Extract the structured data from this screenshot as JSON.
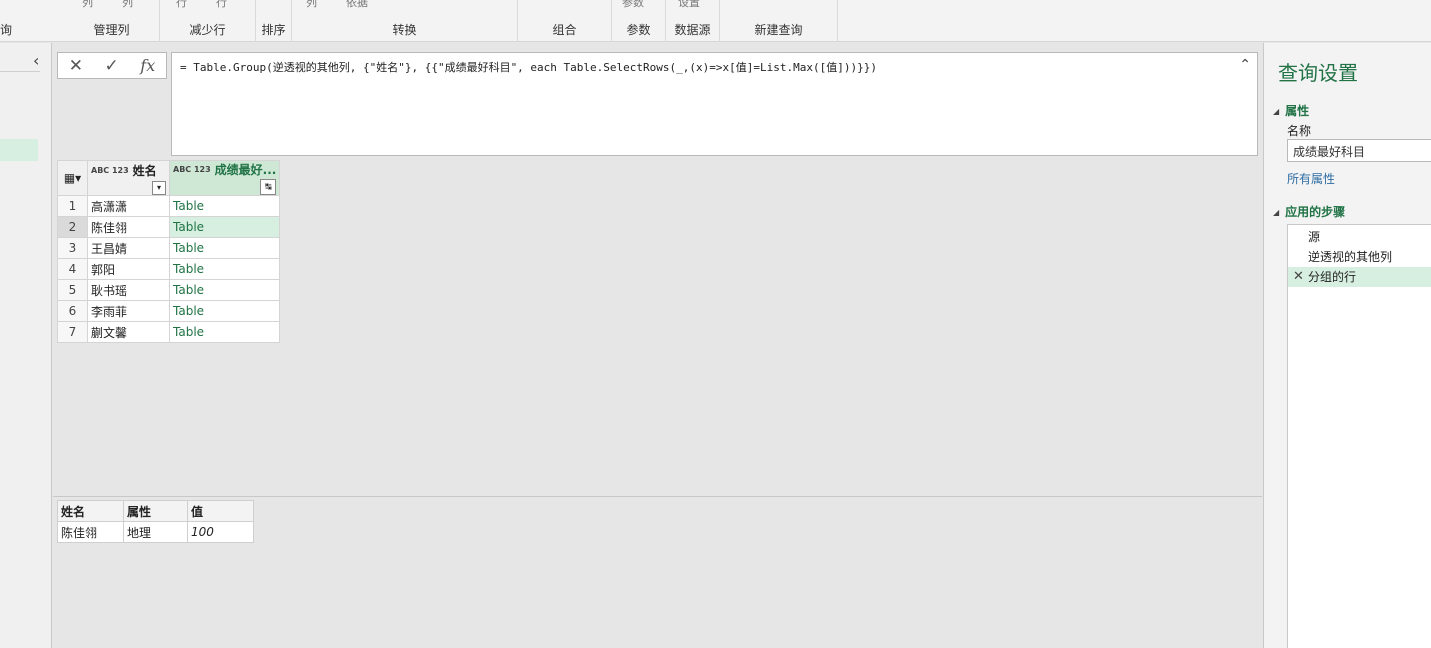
{
  "ribbon": {
    "left_clip": "询",
    "peek": {
      "col1": "列",
      "col2": "列",
      "row1": "行",
      "row2": "行",
      "col3": "列",
      "basis": "依据",
      "param": "参数",
      "settings": "设置"
    },
    "groups": {
      "manage_columns": "管理列",
      "reduce_rows": "减少行",
      "sort": "排序",
      "transform": "转换",
      "combine": "组合",
      "parameters": "参数",
      "data_source": "数据源",
      "new_query": "新建查询"
    }
  },
  "formula": {
    "cancel_icon": "✕",
    "confirm_icon": "✓",
    "fx_icon": "fx",
    "text": "= Table.Group(逆透视的其他列, {\"姓名\"}, {{\"成绩最好科目\", each Table.SelectRows(_,(x)=>x[值]=List.Max([值]))}})",
    "expand_icon": "⌃"
  },
  "grid": {
    "columns": [
      {
        "type": "ABC 123",
        "name": "姓名"
      },
      {
        "type": "ABC 123",
        "name": "成绩最好..."
      }
    ],
    "rows": [
      {
        "num": "1",
        "name": "高潇潇",
        "value": "Table"
      },
      {
        "num": "2",
        "name": "陈佳翎",
        "value": "Table"
      },
      {
        "num": "3",
        "name": "王昌婧",
        "value": "Table"
      },
      {
        "num": "4",
        "name": "郭阳",
        "value": "Table"
      },
      {
        "num": "5",
        "name": "耿书瑶",
        "value": "Table"
      },
      {
        "num": "6",
        "name": "李雨菲",
        "value": "Table"
      },
      {
        "num": "7",
        "name": "蒯文馨",
        "value": "Table"
      }
    ],
    "selected_row": "2"
  },
  "preview": {
    "headers": [
      "姓名",
      "属性",
      "值"
    ],
    "row": [
      "陈佳翎",
      "地理",
      "100"
    ]
  },
  "query_settings": {
    "title": "查询设置",
    "properties_label": "属性",
    "name_label": "名称",
    "name_value": "成绩最好科目",
    "all_properties_link": "所有属性",
    "applied_steps_label": "应用的步骤",
    "steps": [
      "源",
      "逆透视的其他列",
      "分组的行"
    ],
    "active_step": "分组的行"
  },
  "colors": {
    "accent": "#217346",
    "selection": "#d6efe0",
    "link": "#2e6da4"
  }
}
